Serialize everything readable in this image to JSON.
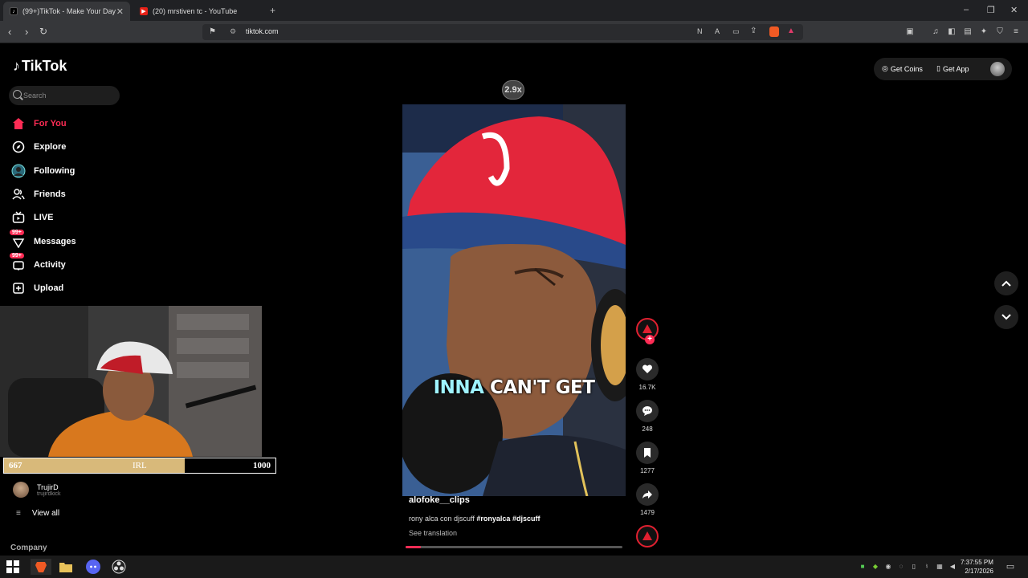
{
  "browser": {
    "tabs": [
      {
        "title": "(99+)TikTok - Make Your Day",
        "active": true
      },
      {
        "title": "(20) mrstiven tc - YouTube",
        "active": false
      }
    ],
    "new_tab_label": "+",
    "url": "tiktok.com",
    "window_controls": {
      "minimize": "–",
      "restore": "❐",
      "close": "✕"
    }
  },
  "tiktok": {
    "logo_text": "TikTok",
    "search": {
      "placeholder": "Search"
    },
    "nav": [
      {
        "label": "For You",
        "icon": "home-icon",
        "active": true
      },
      {
        "label": "Explore",
        "icon": "compass-icon"
      },
      {
        "label": "Following",
        "icon": "following-avatar-icon"
      },
      {
        "label": "Friends",
        "icon": "friends-icon"
      },
      {
        "label": "LIVE",
        "icon": "live-tv-icon"
      },
      {
        "label": "Messages",
        "icon": "messages-icon",
        "badge": "99+"
      },
      {
        "label": "Activity",
        "icon": "activity-icon",
        "badge": "99+"
      },
      {
        "label": "Upload",
        "icon": "upload-icon"
      }
    ],
    "following_account": {
      "name": "TrujirD",
      "handle": "trujirdkick"
    },
    "view_all": "View all",
    "company": "Company",
    "top_right": {
      "get_coins": "Get Coins",
      "get_app": "Get App"
    }
  },
  "stream_overlay": {
    "goal_current": "667",
    "goal_label": "IRL",
    "goal_target": "1000",
    "goal_fraction": 0.667
  },
  "video": {
    "speed": "2.9x",
    "caption_highlight": "INNA",
    "caption_rest": " CAN'T GET",
    "author": "alofoke__clips",
    "description": "rony alca con djscuff",
    "tags": [
      "#ronyalca",
      "#djscuff"
    ],
    "see_translation": "See translation",
    "progress_fraction": 0.07,
    "likes": "16.7K",
    "comments": "248",
    "saves": "1277",
    "shares": "1479"
  },
  "taskbar": {
    "time": "7:37:55 PM",
    "date": "2/17/2026"
  },
  "colors": {
    "accent": "#fe2c55",
    "bg": "#000000",
    "goal_fill": "#d8b97a"
  }
}
